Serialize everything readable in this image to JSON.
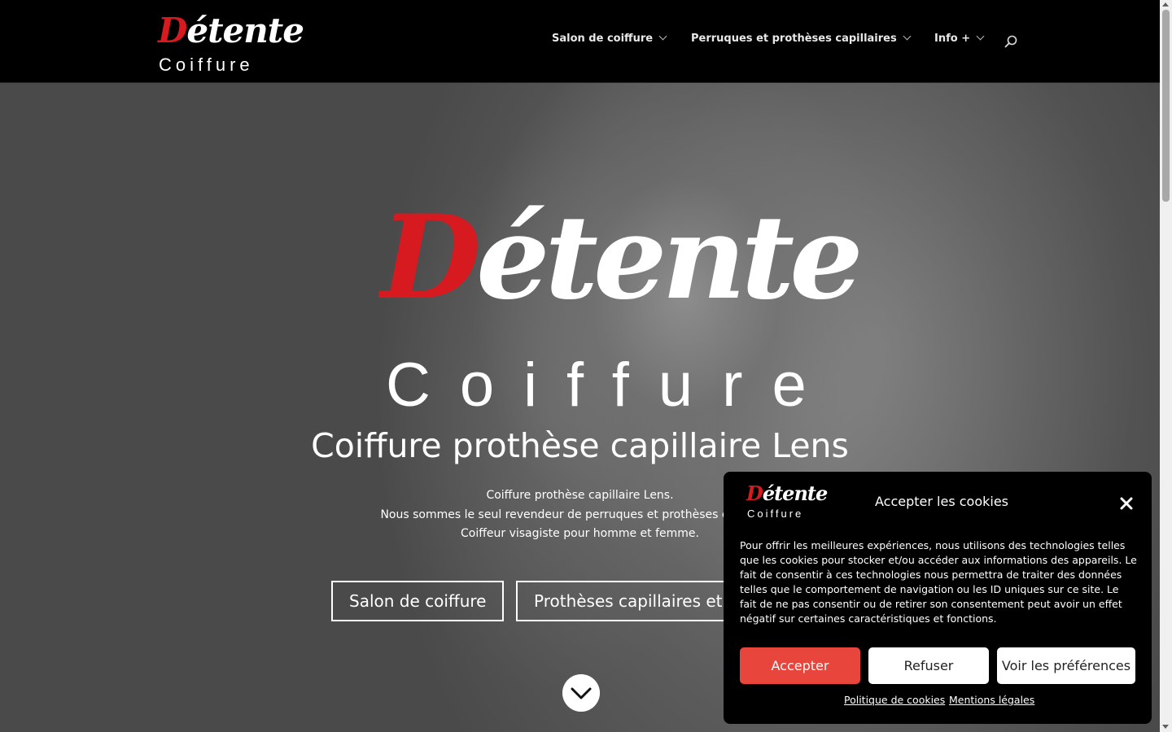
{
  "header": {
    "logo": {
      "script_first": "D",
      "script_rest": "étente",
      "word": "Coiffure"
    },
    "nav": [
      {
        "label": "Salon de coiffure"
      },
      {
        "label": "Perruques et prothèses capillaires"
      },
      {
        "label": "Info +"
      }
    ],
    "search_icon": "search-icon"
  },
  "hero": {
    "logo": {
      "script_first": "D",
      "script_rest": "étente",
      "word": "Coiffure"
    },
    "title": "Coiffure prothèse capillaire Lens",
    "lines": [
      "Coiffure prothèse capillaire Lens.",
      "Nous sommes le seul revendeur de perruques et prothèses capillaires",
      "Coiffeur visagiste pour homme et femme."
    ],
    "buttons": [
      {
        "label": "Salon de coiffure"
      },
      {
        "label": "Prothèses capillaires et"
      }
    ],
    "scroll_down_icon": "chevron-down-icon"
  },
  "cookie": {
    "logo": {
      "script_first": "D",
      "script_rest": "étente",
      "word": "Coiffure"
    },
    "title": "Accepter les cookies",
    "text": "Pour offrir les meilleures expériences, nous utilisons des technologies telles que les cookies pour stocker et/ou accéder aux informations des appareils. Le fait de consentir à ces technologies nous permettra de traiter des données telles que le comportement de navigation ou les ID uniques sur ce site. Le fait de ne pas consentir ou de retirer son consentement peut avoir un effet négatif sur certaines caractéristiques et fonctions.",
    "accept": "Accepter",
    "refuse": "Refuser",
    "prefs": "Voir les préférences",
    "links": [
      "Politique de cookies",
      "Mentions légales"
    ],
    "accent_color": "#e8453c"
  },
  "colors": {
    "brand_red": "#d71920",
    "header_bg": "#000000"
  }
}
